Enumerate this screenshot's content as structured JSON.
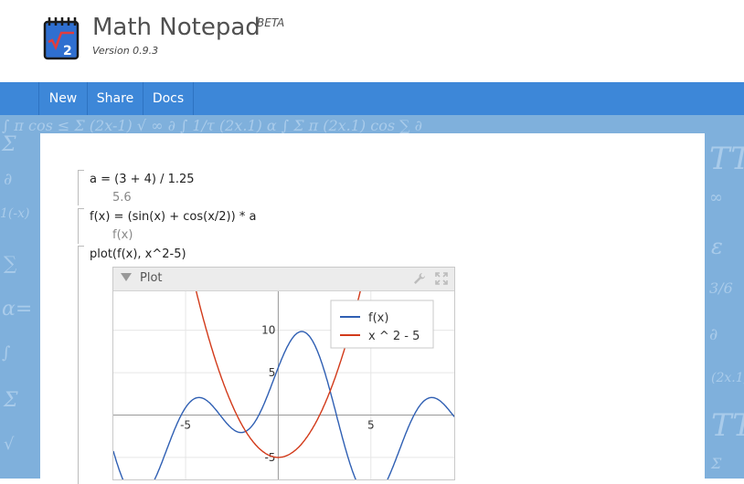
{
  "app": {
    "title": "Math Notepad",
    "badge": "BETA",
    "version": "Version 0.9.3",
    "logo_icon": "notepad-sqrt2-icon",
    "logo_text": "√2"
  },
  "nav": {
    "items": [
      {
        "label": "New"
      },
      {
        "label": "Share"
      },
      {
        "label": "Docs"
      }
    ]
  },
  "lines": [
    {
      "expr": "a = (3 + 4) / 1.25",
      "result": "5.6"
    },
    {
      "expr": "f(x) = (sin(x) + cos(x/2)) * a",
      "result": "f(x)"
    },
    {
      "expr": "plot(f(x), x^2-5)"
    }
  ],
  "plot": {
    "title": "Plot",
    "toolbar": [
      "wrench-icon",
      "fullscreen-icon"
    ]
  },
  "chart_data": {
    "type": "line",
    "title": "",
    "xlabel": "",
    "ylabel": "",
    "xlim": [
      -8.9,
      9.5
    ],
    "ylim": [
      -7.6,
      14.6
    ],
    "x_ticks": [
      -5,
      5
    ],
    "y_ticks": [
      -5,
      5,
      10
    ],
    "grid": true,
    "legend": "top-right",
    "series": [
      {
        "name": "f(x)",
        "formula": "(sin(x) + cos(x/2)) * 5.6",
        "color": "#2f5fb3"
      },
      {
        "name": "x ^ 2 - 5",
        "formula": "x^2 - 5",
        "color": "#d23a1a"
      }
    ]
  },
  "colors": {
    "nav": "#3d87d8",
    "background": "#7fb0dc",
    "series1": "#2f5fb3",
    "series2": "#d23a1a"
  }
}
